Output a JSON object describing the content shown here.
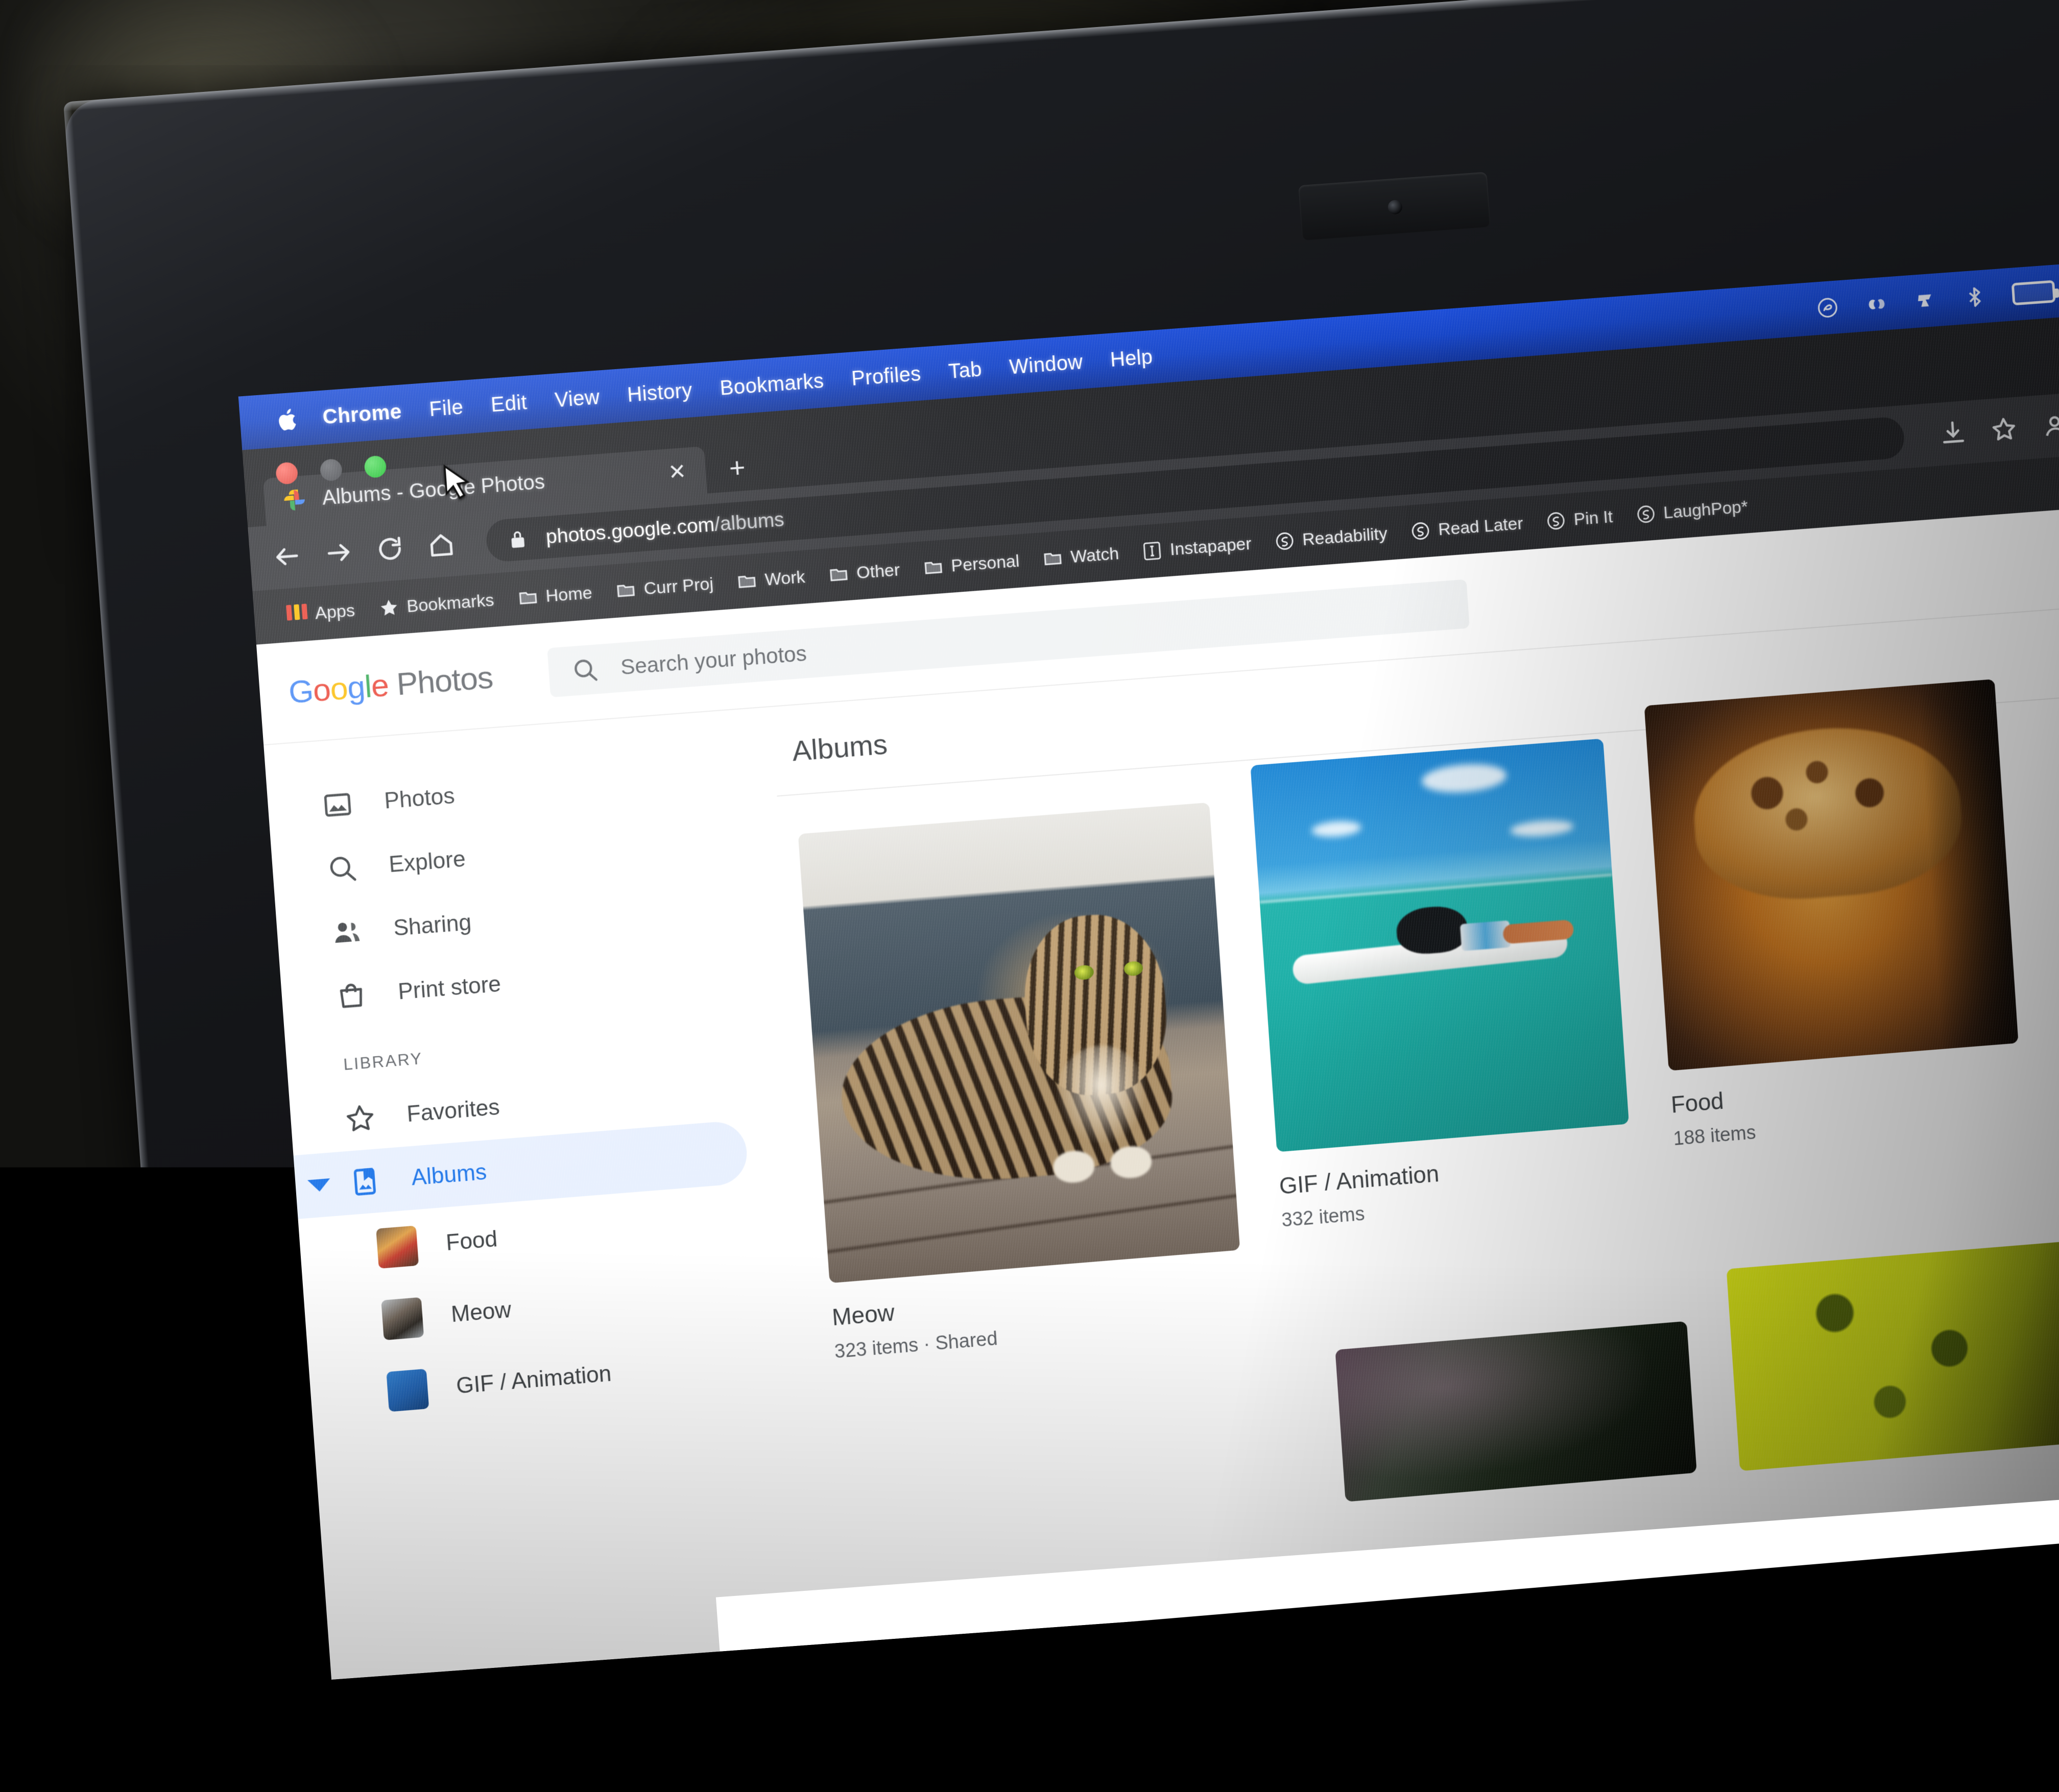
{
  "menubar": {
    "apple_icon": "apple-icon",
    "items": [
      {
        "label": "Chrome",
        "bold": true
      },
      {
        "label": "File",
        "bold": false
      },
      {
        "label": "Edit",
        "bold": false
      },
      {
        "label": "View",
        "bold": false
      },
      {
        "label": "History",
        "bold": false
      },
      {
        "label": "Bookmarks",
        "bold": false
      },
      {
        "label": "Profiles",
        "bold": false
      },
      {
        "label": "Tab",
        "bold": false
      },
      {
        "label": "Window",
        "bold": false
      },
      {
        "label": "Help",
        "bold": false
      }
    ],
    "status_icons": [
      "creative-cloud-icon",
      "webex-icon",
      "app-icon",
      "bluetooth-icon",
      "battery-icon"
    ],
    "background_color": "#1746c8"
  },
  "window_controls": {
    "close": "close-window-button",
    "minimize": "minimize-window-button",
    "zoom": "zoom-window-button"
  },
  "browser": {
    "tab": {
      "title": "Albums - Google Photos",
      "favicon": "google-photos-favicon",
      "close_label": "✕"
    },
    "new_tab_label": "+",
    "toolbar": {
      "back": "back-arrow-icon",
      "forward": "forward-arrow-icon",
      "reload": "reload-icon",
      "home": "home-icon",
      "lock": "lock-icon",
      "url_host": "photos.google.com",
      "url_path": "/albums",
      "download": "download-icon",
      "bookmark_star": "star-icon",
      "profile": "profile-icon"
    },
    "bookmarks": [
      {
        "label": "Apps",
        "icon": "apps-grid-icon"
      },
      {
        "label": "Bookmarks",
        "icon": "star-icon"
      },
      {
        "label": "Home",
        "icon": "folder-icon"
      },
      {
        "label": "Curr Proj",
        "icon": "folder-icon"
      },
      {
        "label": "Work",
        "icon": "folder-icon"
      },
      {
        "label": "Other",
        "icon": "folder-icon"
      },
      {
        "label": "Personal",
        "icon": "folder-icon"
      },
      {
        "label": "Watch",
        "icon": "folder-icon"
      },
      {
        "label": "Instapaper",
        "icon": "instapaper-icon"
      },
      {
        "label": "Readability",
        "icon": "readability-icon"
      },
      {
        "label": "Read Later",
        "icon": "readability-icon"
      },
      {
        "label": "Pin It",
        "icon": "readability-icon"
      },
      {
        "label": "LaughPop*",
        "icon": "readability-icon"
      }
    ]
  },
  "photos": {
    "logo": {
      "google": "Google",
      "product": "Photos"
    },
    "logo_colors": [
      "#4285f4",
      "#ea4335",
      "#fbbc05",
      "#4285f4",
      "#34a853",
      "#ea4335"
    ],
    "search": {
      "placeholder": "Search your photos",
      "icon": "search-icon"
    },
    "sidebar": {
      "nav": [
        {
          "label": "Photos",
          "icon": "photo-icon",
          "selected": false
        },
        {
          "label": "Explore",
          "icon": "search-icon",
          "selected": false
        },
        {
          "label": "Sharing",
          "icon": "people-icon",
          "selected": false
        },
        {
          "label": "Print store",
          "icon": "shopping-bag-icon",
          "selected": false
        }
      ],
      "section_label": "LIBRARY",
      "library": [
        {
          "label": "Favorites",
          "icon": "star-outline-icon",
          "selected": false
        },
        {
          "label": "Albums",
          "icon": "albums-icon",
          "selected": true,
          "expanded": true
        }
      ],
      "album_children": [
        {
          "label": "Food",
          "thumb_class": "th-food"
        },
        {
          "label": "Meow",
          "thumb_class": "th-meow"
        },
        {
          "label": "GIF / Animation",
          "thumb_class": "th-gif"
        }
      ],
      "selected_color": "#1a73e8",
      "selected_bg": "#e8f0fe"
    },
    "main": {
      "title": "Albums",
      "albums": [
        {
          "title": "Meow",
          "meta": "323 items  ·  Shared",
          "cover": "tabby-cat-on-deck"
        },
        {
          "title": "GIF / Animation",
          "meta": "332 items",
          "cover": "surfer-on-board"
        },
        {
          "title": "Food",
          "meta": "188 items",
          "cover": "baked-dessert-with-nuts"
        }
      ]
    }
  }
}
